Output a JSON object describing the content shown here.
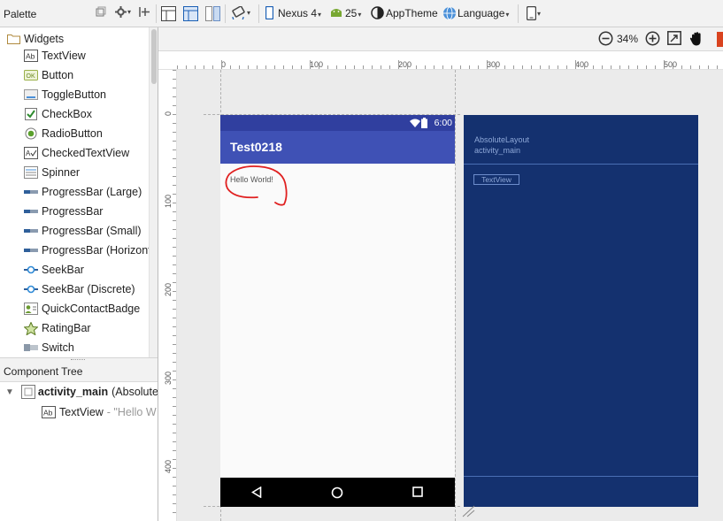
{
  "palette": {
    "title": "Palette",
    "group": "Widgets",
    "items": [
      {
        "label": "TextView",
        "icon": "textview-icon"
      },
      {
        "label": "Button",
        "icon": "button-icon"
      },
      {
        "label": "ToggleButton",
        "icon": "togglebutton-icon"
      },
      {
        "label": "CheckBox",
        "icon": "checkbox-icon"
      },
      {
        "label": "RadioButton",
        "icon": "radiobutton-icon"
      },
      {
        "label": "CheckedTextView",
        "icon": "checkedtextview-icon"
      },
      {
        "label": "Spinner",
        "icon": "spinner-icon"
      },
      {
        "label": "ProgressBar (Large)",
        "icon": "progressbar-icon"
      },
      {
        "label": "ProgressBar",
        "icon": "progressbar-icon"
      },
      {
        "label": "ProgressBar (Small)",
        "icon": "progressbar-icon"
      },
      {
        "label": "ProgressBar (Horizonta",
        "icon": "progressbar-icon"
      },
      {
        "label": "SeekBar",
        "icon": "seekbar-icon"
      },
      {
        "label": "SeekBar (Discrete)",
        "icon": "seekbar-icon"
      },
      {
        "label": "QuickContactBadge",
        "icon": "contact-icon"
      },
      {
        "label": "RatingBar",
        "icon": "star-icon"
      },
      {
        "label": "Switch",
        "icon": "switch-icon"
      }
    ]
  },
  "toolbar": {
    "device": "Nexus 4",
    "api": "25",
    "theme": "AppTheme",
    "language": "Language"
  },
  "zoom": {
    "level": "34%"
  },
  "component_tree": {
    "title": "Component Tree",
    "root_name": "activity_main",
    "root_type": "(Absolute",
    "child_name": "TextView",
    "child_value": "- \"Hello W"
  },
  "ruler": {
    "h_labels": [
      "0",
      "100",
      "200",
      "300",
      "400",
      "500"
    ],
    "v_labels": [
      "0",
      "100",
      "200",
      "300",
      "400"
    ]
  },
  "phone": {
    "time": "6:00",
    "app_title": "Test0218",
    "hello_text": "Hello World!"
  },
  "blueprint": {
    "layout_type": "AbsoluteLayout",
    "layout_id": "activity_main",
    "textview_label": "TextView"
  },
  "colors": {
    "primary": "#3f51b5",
    "primary_dark": "#303f9f",
    "blueprint": "#14316f",
    "annotation": "#e02020"
  }
}
